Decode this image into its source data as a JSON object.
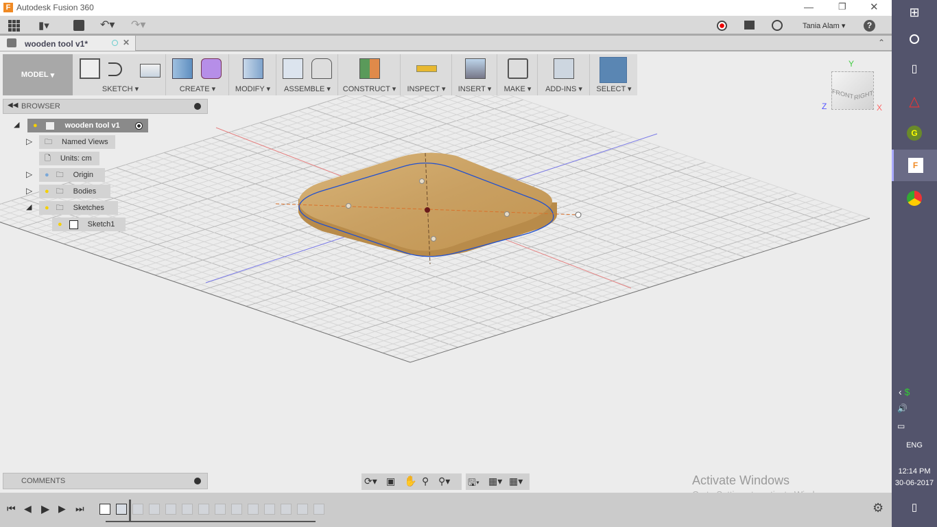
{
  "window": {
    "title": "Autodesk Fusion 360"
  },
  "quick_access": {
    "user": "Tania Alam"
  },
  "document_tab": {
    "label": "wooden tool v1*"
  },
  "ribbon": {
    "workspace": "MODEL",
    "groups": [
      {
        "label": "SKETCH"
      },
      {
        "label": "CREATE"
      },
      {
        "label": "MODIFY"
      },
      {
        "label": "ASSEMBLE"
      },
      {
        "label": "CONSTRUCT"
      },
      {
        "label": "INSPECT"
      },
      {
        "label": "INSERT"
      },
      {
        "label": "MAKE"
      },
      {
        "label": "ADD-INS"
      },
      {
        "label": "SELECT"
      }
    ]
  },
  "browser": {
    "title": "BROWSER",
    "items": [
      {
        "label": "wooden tool v1"
      },
      {
        "label": "Named Views"
      },
      {
        "label": "Units: cm"
      },
      {
        "label": "Origin"
      },
      {
        "label": "Bodies"
      },
      {
        "label": "Sketches"
      },
      {
        "label": "Sketch1"
      }
    ]
  },
  "viewcube": {
    "front": "FRONT",
    "right": "RIGHT",
    "x": "X",
    "y": "Y",
    "z": "Z"
  },
  "comments": {
    "title": "COMMENTS"
  },
  "watermark": {
    "title": "Activate Windows",
    "subtitle": "Go to Settings to activate Windows."
  },
  "taskbar": {
    "language": "ENG",
    "time": "12:14 PM",
    "date": "30-06-2017",
    "bg": "#53546c"
  },
  "colors": {
    "accent_select": "#5a86b3",
    "x_axis": "#e05050",
    "z_axis": "#5050e0",
    "sketch_line": "#2050d0"
  }
}
